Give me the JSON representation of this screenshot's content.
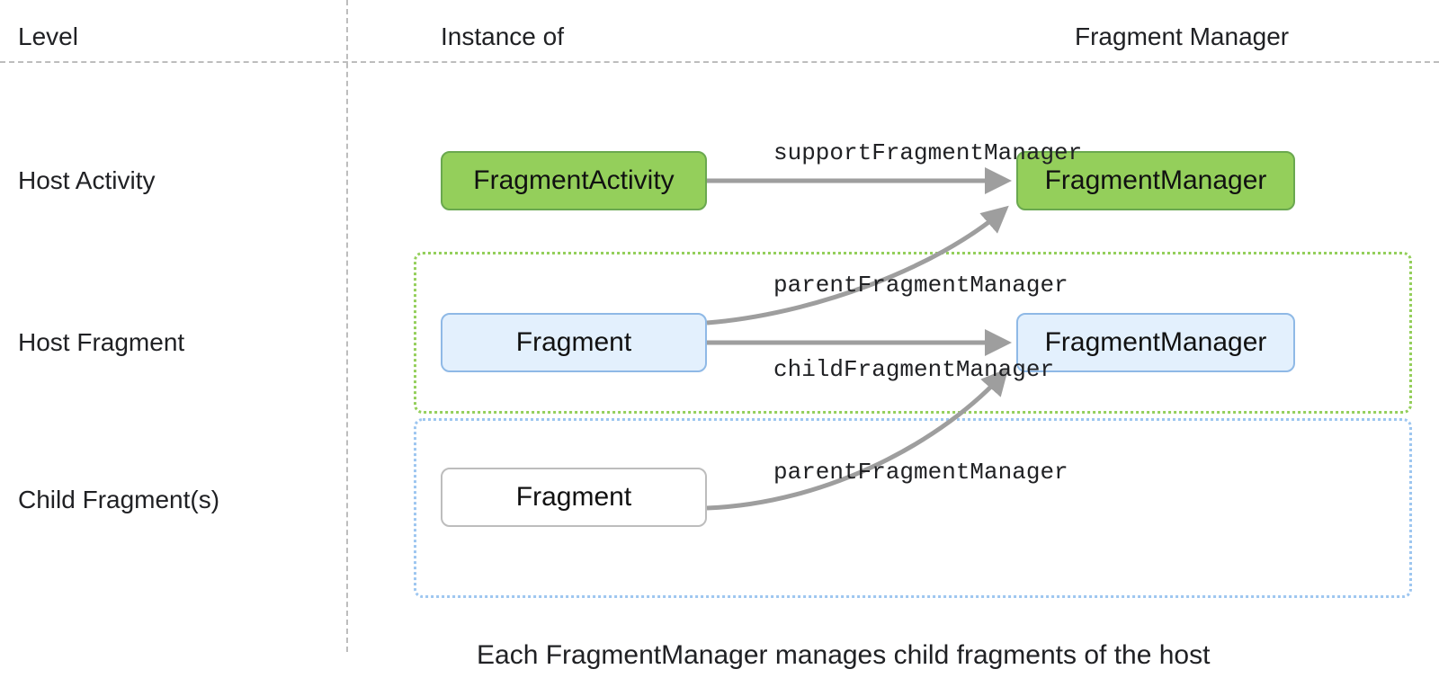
{
  "headers": {
    "level": "Level",
    "instance": "Instance of",
    "fm": "Fragment Manager"
  },
  "rows": {
    "hostActivity": "Host Activity",
    "hostFragment": "Host Fragment",
    "childFragments": "Child Fragment(s)"
  },
  "nodes": {
    "fragmentActivity": "FragmentActivity",
    "fragmentManager1": "FragmentManager",
    "hostFragment": "Fragment",
    "fragmentManager2": "FragmentManager",
    "childFragment": "Fragment"
  },
  "edges": {
    "supportFM": "supportFragmentManager",
    "parentFM1": "parentFragmentManager",
    "childFM": "childFragmentManager",
    "parentFM2": "parentFragmentManager"
  },
  "caption": "Each FragmentManager manages child fragments of the host",
  "colors": {
    "green_fill": "#94cf5b",
    "green_border": "#6aa84f",
    "blue_fill": "#e3f0fd",
    "blue_border": "#8fb9e6",
    "gray": "#9e9e9e"
  }
}
